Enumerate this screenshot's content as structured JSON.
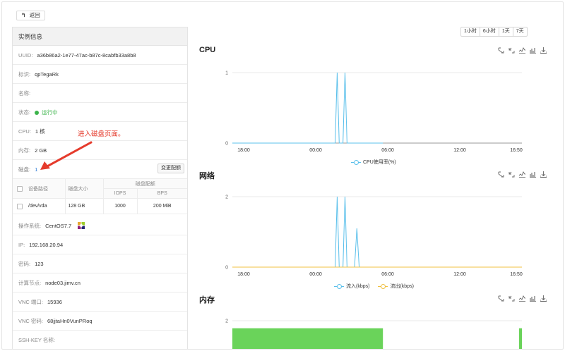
{
  "back_button": {
    "icon": "back-arrow-icon",
    "label": "返回"
  },
  "instance_panel": {
    "title": "实例信息",
    "uuid": {
      "label": "UUID:",
      "value": "a36b86a2-1e77-47ac-b87c-8cabfb33a8b8"
    },
    "tag": {
      "label": "标识:",
      "value": "qpTegaRk"
    },
    "name": {
      "label": "名称:",
      "value": ""
    },
    "status": {
      "label": "状态:",
      "value": "运行中",
      "color": "#3cb44b"
    },
    "cpu": {
      "label": "CPU:",
      "value": "1 核"
    },
    "memory": {
      "label": "内存:",
      "value": "2 GB"
    },
    "disk": {
      "label": "磁盘:",
      "value": "1",
      "change_button": "变更配额"
    },
    "disk_table": {
      "headers": [
        "设备路径",
        "磁盘大小",
        "磁盘配额",
        "IOPS",
        "BPS"
      ],
      "rows": [
        {
          "path": "/dev/vda",
          "size": "128 GB",
          "iops": "1000",
          "bps": "200 MiB"
        }
      ]
    },
    "os": {
      "label": "操作系统:",
      "value": "CentOS7.7",
      "icon": "centos-logo-icon"
    },
    "ip": {
      "label": "IP:",
      "value": "192.168.20.94"
    },
    "password": {
      "label": "密码:",
      "value": "123"
    },
    "compute_node": {
      "label": "计算节点:",
      "value": "node03.jimv.cn"
    },
    "vnc_port": {
      "label": "VNC 端口:",
      "value": "15936"
    },
    "vnc_password": {
      "label": "VNC 密码:",
      "value": "68jjtaHn0VunPRoq"
    },
    "ssh_key": {
      "label": "SSH-KEY 名称:",
      "value": ""
    }
  },
  "annotation": {
    "text": "进入磁盘页面。",
    "color": "#e53b2c"
  },
  "time_range": {
    "options": [
      "1小时",
      "6小时",
      "1天",
      "7天"
    ]
  },
  "toolbox": {
    "icons": [
      "zoom-icon",
      "zoom-reset-icon",
      "line-chart-icon",
      "bar-chart-icon",
      "download-icon"
    ]
  },
  "charts_text": {
    "cpu_title": "CPU",
    "network_title": "网络",
    "memory_title": "内存"
  },
  "chart_data": [
    {
      "type": "line",
      "title": "CPU",
      "x_ticks": [
        "18:00",
        "00:00",
        "06:00",
        "12:00",
        "16:50"
      ],
      "y_ticks": [
        "0",
        "1"
      ],
      "ylim": [
        0,
        1
      ],
      "series": [
        {
          "name": "CPU使用率(%)",
          "color": "#5bc0eb",
          "points": [
            [
              0.0,
              0
            ],
            [
              0.355,
              0
            ],
            [
              0.362,
              1
            ],
            [
              0.369,
              0
            ],
            [
              0.382,
              0
            ],
            [
              0.389,
              1
            ],
            [
              0.396,
              0
            ],
            [
              0.52,
              0
            ]
          ]
        }
      ]
    },
    {
      "type": "line",
      "title": "网络",
      "x_ticks": [
        "18:00",
        "00:00",
        "06:00",
        "12:00",
        "16:50"
      ],
      "y_ticks": [
        "0",
        "2"
      ],
      "ylim": [
        0,
        2
      ],
      "series": [
        {
          "name": "流入(kbps)",
          "color": "#5bc0eb",
          "points": [
            [
              0.0,
              0
            ],
            [
              0.355,
              0
            ],
            [
              0.362,
              2
            ],
            [
              0.369,
              0
            ],
            [
              0.382,
              0
            ],
            [
              0.389,
              2
            ],
            [
              0.396,
              0
            ],
            [
              0.422,
              0
            ],
            [
              0.43,
              1.1
            ],
            [
              0.438,
              0
            ],
            [
              0.52,
              0
            ]
          ]
        },
        {
          "name": "流出(kbps)",
          "color": "#f0c040",
          "points": [
            [
              0.0,
              0
            ],
            [
              1.0,
              0
            ]
          ]
        }
      ]
    },
    {
      "type": "area",
      "title": "内存",
      "y_ticks": [
        "2"
      ],
      "ylim": [
        0,
        2
      ],
      "series": [
        {
          "name": "",
          "color": "#6ad35a",
          "points": [
            [
              0.0,
              1.55
            ],
            [
              0.52,
              1.55
            ],
            [
              0.52,
              0
            ],
            [
              0.99,
              0
            ],
            [
              0.99,
              1.55
            ],
            [
              1.0,
              1.55
            ]
          ]
        }
      ]
    }
  ]
}
